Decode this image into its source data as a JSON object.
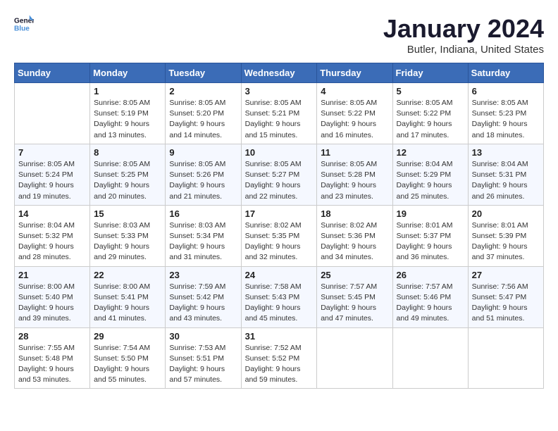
{
  "header": {
    "logo_line1": "General",
    "logo_line2": "Blue",
    "month_title": "January 2024",
    "location": "Butler, Indiana, United States"
  },
  "weekdays": [
    "Sunday",
    "Monday",
    "Tuesday",
    "Wednesday",
    "Thursday",
    "Friday",
    "Saturday"
  ],
  "weeks": [
    [
      {
        "day": "",
        "sunrise": "",
        "sunset": "",
        "daylight": "",
        "empty": true
      },
      {
        "day": "1",
        "sunrise": "Sunrise: 8:05 AM",
        "sunset": "Sunset: 5:19 PM",
        "daylight": "Daylight: 9 hours and 13 minutes."
      },
      {
        "day": "2",
        "sunrise": "Sunrise: 8:05 AM",
        "sunset": "Sunset: 5:20 PM",
        "daylight": "Daylight: 9 hours and 14 minutes."
      },
      {
        "day": "3",
        "sunrise": "Sunrise: 8:05 AM",
        "sunset": "Sunset: 5:21 PM",
        "daylight": "Daylight: 9 hours and 15 minutes."
      },
      {
        "day": "4",
        "sunrise": "Sunrise: 8:05 AM",
        "sunset": "Sunset: 5:22 PM",
        "daylight": "Daylight: 9 hours and 16 minutes."
      },
      {
        "day": "5",
        "sunrise": "Sunrise: 8:05 AM",
        "sunset": "Sunset: 5:22 PM",
        "daylight": "Daylight: 9 hours and 17 minutes."
      },
      {
        "day": "6",
        "sunrise": "Sunrise: 8:05 AM",
        "sunset": "Sunset: 5:23 PM",
        "daylight": "Daylight: 9 hours and 18 minutes."
      }
    ],
    [
      {
        "day": "7",
        "sunrise": "Sunrise: 8:05 AM",
        "sunset": "Sunset: 5:24 PM",
        "daylight": "Daylight: 9 hours and 19 minutes."
      },
      {
        "day": "8",
        "sunrise": "Sunrise: 8:05 AM",
        "sunset": "Sunset: 5:25 PM",
        "daylight": "Daylight: 9 hours and 20 minutes."
      },
      {
        "day": "9",
        "sunrise": "Sunrise: 8:05 AM",
        "sunset": "Sunset: 5:26 PM",
        "daylight": "Daylight: 9 hours and 21 minutes."
      },
      {
        "day": "10",
        "sunrise": "Sunrise: 8:05 AM",
        "sunset": "Sunset: 5:27 PM",
        "daylight": "Daylight: 9 hours and 22 minutes."
      },
      {
        "day": "11",
        "sunrise": "Sunrise: 8:05 AM",
        "sunset": "Sunset: 5:28 PM",
        "daylight": "Daylight: 9 hours and 23 minutes."
      },
      {
        "day": "12",
        "sunrise": "Sunrise: 8:04 AM",
        "sunset": "Sunset: 5:29 PM",
        "daylight": "Daylight: 9 hours and 25 minutes."
      },
      {
        "day": "13",
        "sunrise": "Sunrise: 8:04 AM",
        "sunset": "Sunset: 5:31 PM",
        "daylight": "Daylight: 9 hours and 26 minutes."
      }
    ],
    [
      {
        "day": "14",
        "sunrise": "Sunrise: 8:04 AM",
        "sunset": "Sunset: 5:32 PM",
        "daylight": "Daylight: 9 hours and 28 minutes."
      },
      {
        "day": "15",
        "sunrise": "Sunrise: 8:03 AM",
        "sunset": "Sunset: 5:33 PM",
        "daylight": "Daylight: 9 hours and 29 minutes."
      },
      {
        "day": "16",
        "sunrise": "Sunrise: 8:03 AM",
        "sunset": "Sunset: 5:34 PM",
        "daylight": "Daylight: 9 hours and 31 minutes."
      },
      {
        "day": "17",
        "sunrise": "Sunrise: 8:02 AM",
        "sunset": "Sunset: 5:35 PM",
        "daylight": "Daylight: 9 hours and 32 minutes."
      },
      {
        "day": "18",
        "sunrise": "Sunrise: 8:02 AM",
        "sunset": "Sunset: 5:36 PM",
        "daylight": "Daylight: 9 hours and 34 minutes."
      },
      {
        "day": "19",
        "sunrise": "Sunrise: 8:01 AM",
        "sunset": "Sunset: 5:37 PM",
        "daylight": "Daylight: 9 hours and 36 minutes."
      },
      {
        "day": "20",
        "sunrise": "Sunrise: 8:01 AM",
        "sunset": "Sunset: 5:39 PM",
        "daylight": "Daylight: 9 hours and 37 minutes."
      }
    ],
    [
      {
        "day": "21",
        "sunrise": "Sunrise: 8:00 AM",
        "sunset": "Sunset: 5:40 PM",
        "daylight": "Daylight: 9 hours and 39 minutes."
      },
      {
        "day": "22",
        "sunrise": "Sunrise: 8:00 AM",
        "sunset": "Sunset: 5:41 PM",
        "daylight": "Daylight: 9 hours and 41 minutes."
      },
      {
        "day": "23",
        "sunrise": "Sunrise: 7:59 AM",
        "sunset": "Sunset: 5:42 PM",
        "daylight": "Daylight: 9 hours and 43 minutes."
      },
      {
        "day": "24",
        "sunrise": "Sunrise: 7:58 AM",
        "sunset": "Sunset: 5:43 PM",
        "daylight": "Daylight: 9 hours and 45 minutes."
      },
      {
        "day": "25",
        "sunrise": "Sunrise: 7:57 AM",
        "sunset": "Sunset: 5:45 PM",
        "daylight": "Daylight: 9 hours and 47 minutes."
      },
      {
        "day": "26",
        "sunrise": "Sunrise: 7:57 AM",
        "sunset": "Sunset: 5:46 PM",
        "daylight": "Daylight: 9 hours and 49 minutes."
      },
      {
        "day": "27",
        "sunrise": "Sunrise: 7:56 AM",
        "sunset": "Sunset: 5:47 PM",
        "daylight": "Daylight: 9 hours and 51 minutes."
      }
    ],
    [
      {
        "day": "28",
        "sunrise": "Sunrise: 7:55 AM",
        "sunset": "Sunset: 5:48 PM",
        "daylight": "Daylight: 9 hours and 53 minutes."
      },
      {
        "day": "29",
        "sunrise": "Sunrise: 7:54 AM",
        "sunset": "Sunset: 5:50 PM",
        "daylight": "Daylight: 9 hours and 55 minutes."
      },
      {
        "day": "30",
        "sunrise": "Sunrise: 7:53 AM",
        "sunset": "Sunset: 5:51 PM",
        "daylight": "Daylight: 9 hours and 57 minutes."
      },
      {
        "day": "31",
        "sunrise": "Sunrise: 7:52 AM",
        "sunset": "Sunset: 5:52 PM",
        "daylight": "Daylight: 9 hours and 59 minutes."
      },
      {
        "day": "",
        "sunrise": "",
        "sunset": "",
        "daylight": "",
        "empty": true
      },
      {
        "day": "",
        "sunrise": "",
        "sunset": "",
        "daylight": "",
        "empty": true
      },
      {
        "day": "",
        "sunrise": "",
        "sunset": "",
        "daylight": "",
        "empty": true
      }
    ]
  ]
}
